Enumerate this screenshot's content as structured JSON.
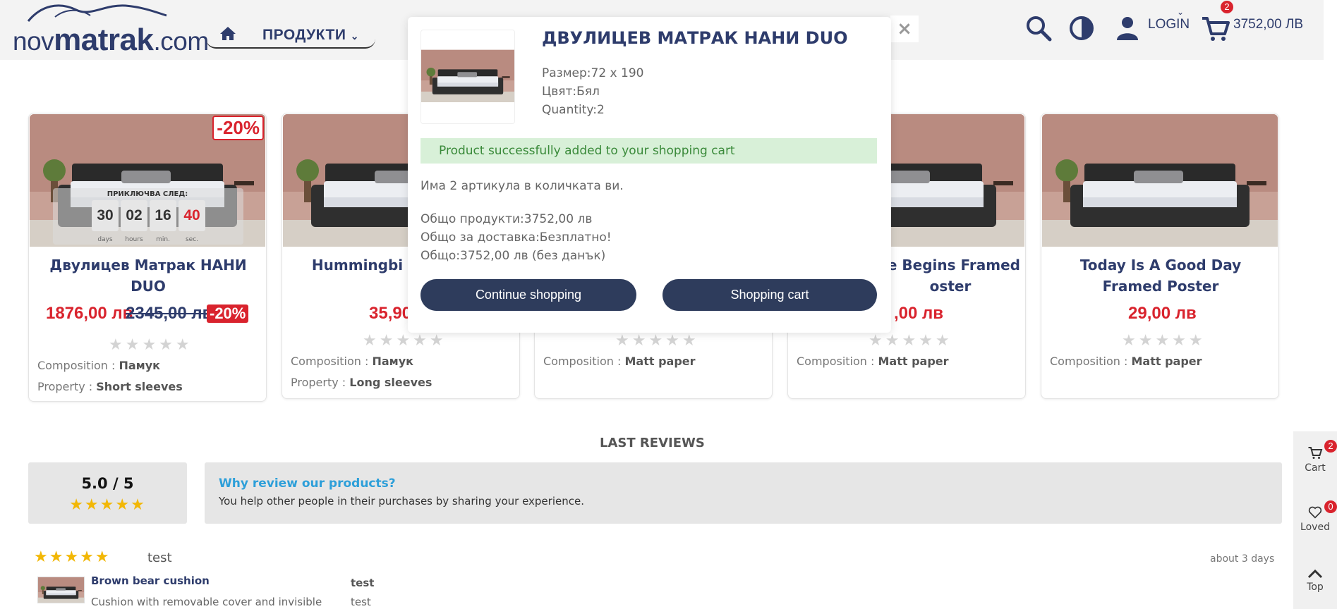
{
  "header": {
    "logo": {
      "prefix": "nov",
      "name": "matrak",
      "suffix": ".com"
    },
    "nav_products": "ПРОДУКТИ",
    "login": "LOGIN",
    "cart_count": "2",
    "cart_total": "3752,00 ЛВ",
    "close": "×"
  },
  "products": [
    {
      "title": "Двулицев Матрак НАНИ DUO",
      "price": "1876,00 лв",
      "old_price": "2345,00 лв",
      "discount": "-20%",
      "countdown_label": "ПРИКЛЮЧВА СЛЕД:",
      "countdown": [
        {
          "value": "30",
          "unit": "days"
        },
        {
          "value": "02",
          "unit": "hours"
        },
        {
          "value": "16",
          "unit": "min."
        },
        {
          "value": "40",
          "unit": "sec."
        }
      ],
      "features": [
        {
          "label": "Composition : ",
          "value": "Памук"
        },
        {
          "label": "Property : ",
          "value": "Short sleeves"
        }
      ]
    },
    {
      "title": "Hummingbi Swea",
      "price": "35,90",
      "features": [
        {
          "label": "Composition : ",
          "value": "Памук"
        },
        {
          "label": "Property : ",
          "value": "Long sleeves"
        }
      ]
    },
    {
      "title": "",
      "features": [
        {
          "label": "Composition : ",
          "value": "Matt paper"
        }
      ]
    },
    {
      "title": "re Begins Framed oster",
      "price": ",00 лв",
      "features": [
        {
          "label": "Composition : ",
          "value": "Matt paper"
        }
      ]
    },
    {
      "title": "Today Is A Good Day Framed Poster",
      "price": "29,00 лв",
      "features": [
        {
          "label": "Composition : ",
          "value": "Matt paper"
        }
      ]
    }
  ],
  "reviews": {
    "title": "LAST REVIEWS",
    "rating": "5.0 / 5",
    "why_title": "Why review our products?",
    "why_text": "You help other people in their purchases by sharing your experience.",
    "items": [
      {
        "name": "test",
        "date": "about 3 days",
        "product": "Brown bear cushion",
        "product_desc": "Cushion with removable cover and invisible",
        "review_title": "test",
        "review_text": "test"
      }
    ]
  },
  "side_panel": {
    "cart_label": "Cart",
    "cart_count": "2",
    "loved_label": "Loved",
    "loved_count": "0",
    "top_label": "Top"
  },
  "modal": {
    "product_title": "ДВУЛИЦЕВ МАТРАК НАНИ DUO",
    "size": "Размер:72 x 190",
    "color": "Цвят:Бял",
    "quantity": "Quantity:2",
    "success": "Product successfully added to your shopping cart",
    "items_in_cart": "Има 2 артикула в количката ви.",
    "total_products": "Общо продукти:3752,00 лв",
    "shipping": "Общо за доставка:Безплатно!",
    "total": "Общо:3752,00 лв (без данък)",
    "continue_btn": "Continue shopping",
    "cart_btn": "Shopping cart"
  },
  "colors": {
    "brand": "#2e3c6c",
    "price_red": "#d9232d",
    "star": "#f2b705",
    "link_blue": "#2d9fd9",
    "success_bg": "#d8f0d8"
  }
}
